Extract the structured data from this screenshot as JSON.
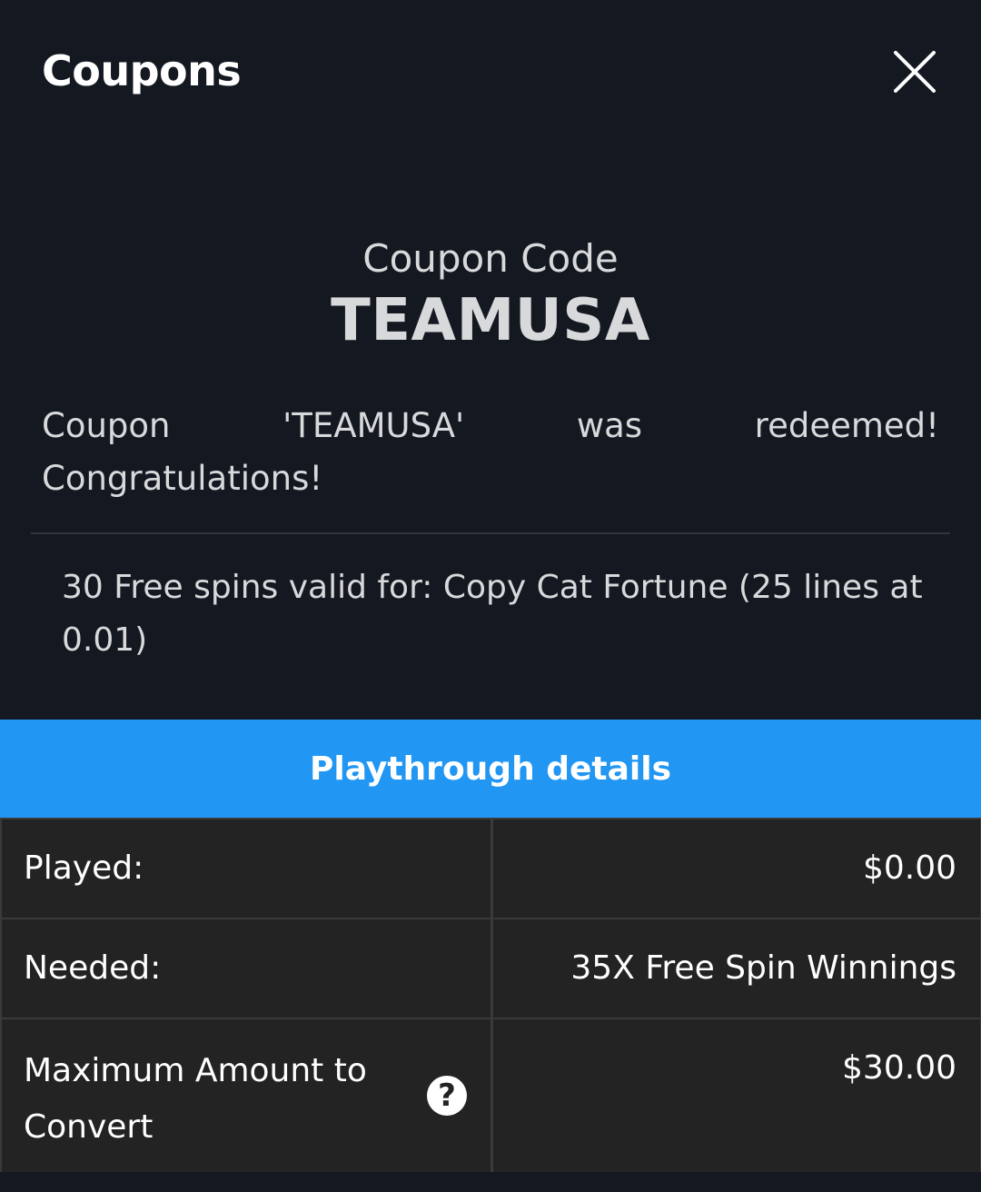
{
  "header": {
    "title": "Coupons",
    "close_icon": "close-icon"
  },
  "coupon": {
    "code_label": "Coupon Code",
    "code_value": "TEAMUSA"
  },
  "message": {
    "line1_words": [
      "Coupon",
      "'TEAMUSA'",
      "was",
      "redeemed!"
    ],
    "line2": "Congratulations!"
  },
  "spins": {
    "text": "30 Free spins valid for: Copy Cat Fortune (25 lines at 0.01)"
  },
  "playthrough": {
    "title": "Playthrough details",
    "accent_color": "#2196f3",
    "rows": [
      {
        "label": "Played:",
        "value": "$0.00"
      },
      {
        "label": "Needed:",
        "value": "35X Free Spin Winnings"
      },
      {
        "label": "Maximum Amount to Convert",
        "value": "$30.00",
        "help_icon": "question-mark-icon",
        "help_glyph": "?"
      }
    ]
  }
}
